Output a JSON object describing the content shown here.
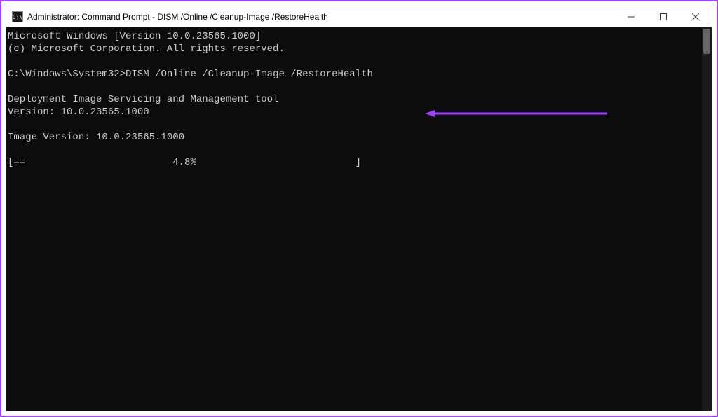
{
  "window": {
    "title": "Administrator: Command Prompt - DISM  /Online /Cleanup-Image /RestoreHealth",
    "icon_label": "C:\\"
  },
  "console": {
    "line_header1": "Microsoft Windows [Version 10.0.23565.1000]",
    "line_header2": "(c) Microsoft Corporation. All rights reserved.",
    "prompt_path": "C:\\Windows\\System32>",
    "command": "DISM /Online /Cleanup-Image /RestoreHealth",
    "tool_name_line": "Deployment Image Servicing and Management tool",
    "tool_version_line": "Version: 10.0.23565.1000",
    "image_version_line": "Image Version: 10.0.23565.1000",
    "progress_line": "[==                         4.8%                           ]"
  },
  "colors": {
    "annotation_purple": "#a040ff"
  }
}
